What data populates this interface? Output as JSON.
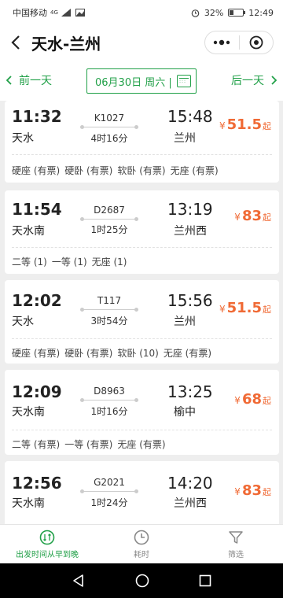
{
  "status_bar": {
    "carrier": "中国移动",
    "network": "4G",
    "battery": "32%",
    "battery_level": 0.32,
    "time": "12:49"
  },
  "header": {
    "title": "天水-兰州"
  },
  "date_bar": {
    "prev_day": "前一天",
    "date": "06月30日 周六 |",
    "next_day": "后一天"
  },
  "trains": [
    {
      "dep_time": "11:32",
      "dep_station": "天水",
      "train_no": "K1027",
      "duration": "4时16分",
      "arr_time": "15:48",
      "arr_station": "兰州",
      "price": "51.5",
      "price_prefix": "¥",
      "price_suffix": "起",
      "seats": [
        "硬座 (有票)",
        "硬卧 (有票)",
        "软卧 (有票)",
        "无座 (有票)"
      ]
    },
    {
      "dep_time": "11:54",
      "dep_station": "天水南",
      "train_no": "D2687",
      "duration": "1时25分",
      "arr_time": "13:19",
      "arr_station": "兰州西",
      "price": "83",
      "price_prefix": "¥",
      "price_suffix": "起",
      "seats": [
        "二等 (1)",
        "一等 (1)",
        "无座 (1)"
      ]
    },
    {
      "dep_time": "12:02",
      "dep_station": "天水",
      "train_no": "T117",
      "duration": "3时54分",
      "arr_time": "15:56",
      "arr_station": "兰州",
      "price": "51.5",
      "price_prefix": "¥",
      "price_suffix": "起",
      "seats": [
        "硬座 (有票)",
        "硬卧 (有票)",
        "软卧 (10)",
        "无座 (有票)"
      ]
    },
    {
      "dep_time": "12:09",
      "dep_station": "天水南",
      "train_no": "D8963",
      "duration": "1时16分",
      "arr_time": "13:25",
      "arr_station": "榆中",
      "price": "68",
      "price_prefix": "¥",
      "price_suffix": "起",
      "seats": [
        "二等 (有票)",
        "一等 (有票)",
        "无座 (有票)"
      ]
    },
    {
      "dep_time": "12:56",
      "dep_station": "天水南",
      "train_no": "G2021",
      "duration": "1时24分",
      "arr_time": "14:20",
      "arr_station": "兰州西",
      "price": "83",
      "price_prefix": "¥",
      "price_suffix": "起",
      "seats": []
    }
  ],
  "tabs": [
    {
      "label": "出发时间从早到晚",
      "icon": "clock-sort-icon",
      "active": true
    },
    {
      "label": "耗时",
      "icon": "clock-icon",
      "active": false
    },
    {
      "label": "筛选",
      "icon": "filter-icon",
      "active": false
    }
  ],
  "colors": {
    "accent": "#21a048",
    "price": "#f06a35"
  }
}
